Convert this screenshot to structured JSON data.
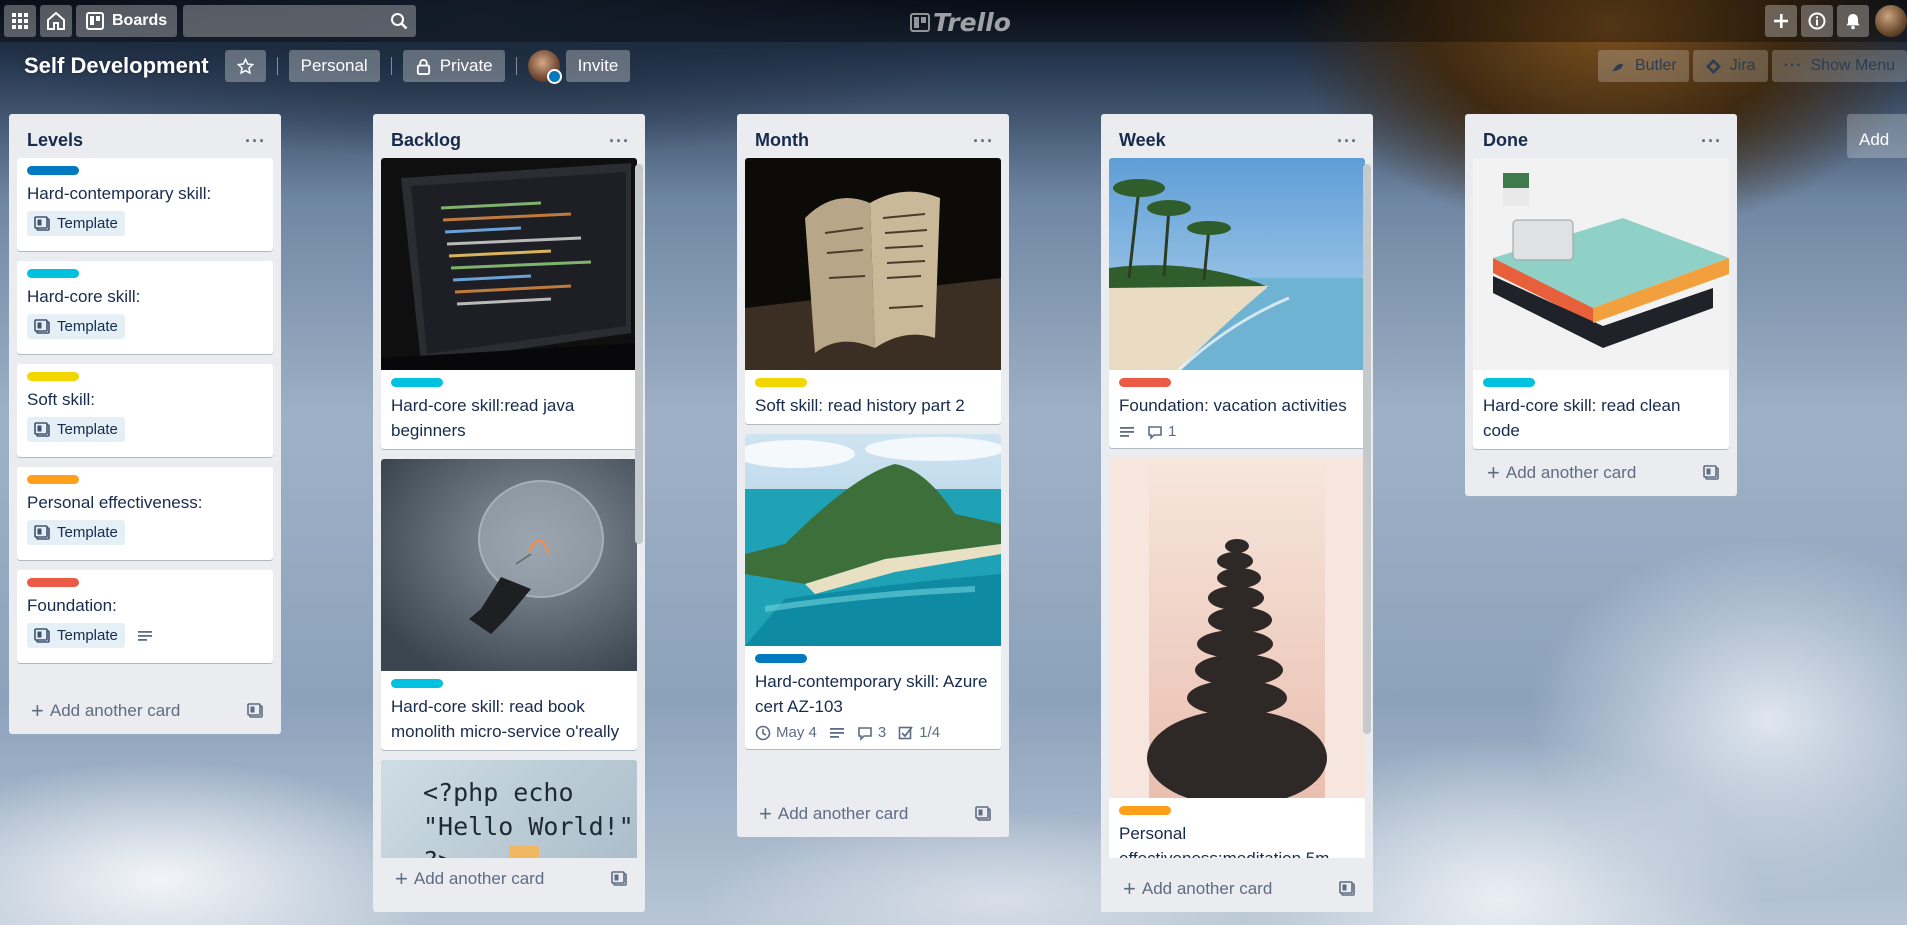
{
  "topbar": {
    "boards_label": "Boards",
    "search_value": "",
    "logo_text": "Trello"
  },
  "board": {
    "title": "Self Development",
    "visibility_team": "Personal",
    "visibility_privacy": "Private",
    "invite_label": "Invite",
    "butler_label": "Butler",
    "jira_label": "Jira",
    "show_menu_label": "Show Menu",
    "add_list_label": "Add"
  },
  "colors": {
    "blue": "#0079bf",
    "sky": "#00c2e0",
    "yellow": "#f2d600",
    "orange": "#ff9f1a",
    "red": "#eb5a46",
    "list_bg": "#ebecf0"
  },
  "lists": [
    {
      "title": "Levels",
      "add_label": "Add another card",
      "cards": [
        {
          "label": "blue",
          "title": "Hard-contemporary skill:",
          "badge": "Template"
        },
        {
          "label": "sky",
          "title": "Hard-core skill:",
          "badge": "Template"
        },
        {
          "label": "yellow",
          "title": "Soft skill:",
          "badge": "Template"
        },
        {
          "label": "orange",
          "title": "Personal effectiveness:",
          "badge": "Template"
        },
        {
          "label": "red",
          "title": "Foundation:",
          "badge": "Template"
        }
      ]
    },
    {
      "title": "Backlog",
      "add_label": "Add another card",
      "cards": [
        {
          "label": "sky",
          "title": "Hard-core skill:read java beginners",
          "cover": "laptop-code-photo"
        },
        {
          "label": "sky",
          "title": "Hard-core skill: read book monolith micro-service o'really",
          "cover": "light-bulb-photo"
        },
        {
          "cover": "php-code-photo",
          "cover_text": [
            "<?php echo",
            "\"Hello World!\"",
            "?>"
          ]
        }
      ]
    },
    {
      "title": "Month",
      "add_label": "Add another card",
      "cards": [
        {
          "label": "yellow",
          "title": "Soft skill: read history part 2",
          "cover": "old-book-photo"
        },
        {
          "label": "blue",
          "title": "Hard-contemporary skill: Azure cert AZ-103",
          "cover": "island-photo",
          "due": "May 4",
          "comments": "3",
          "checklist": "1/4"
        }
      ]
    },
    {
      "title": "Week",
      "add_label": "Add another card",
      "cards": [
        {
          "label": "red",
          "title": "Foundation: vacation activities",
          "cover": "beach-photo",
          "comments": "1"
        },
        {
          "label": "orange",
          "title": "Personal effectiveness:meditation 5m",
          "cover": "stacked-stones-photo"
        }
      ]
    },
    {
      "title": "Done",
      "add_label": "Add another card",
      "cards": [
        {
          "label": "sky",
          "title": "Hard-core skill: read clean code",
          "cover": "books-stack-photo"
        }
      ]
    }
  ]
}
